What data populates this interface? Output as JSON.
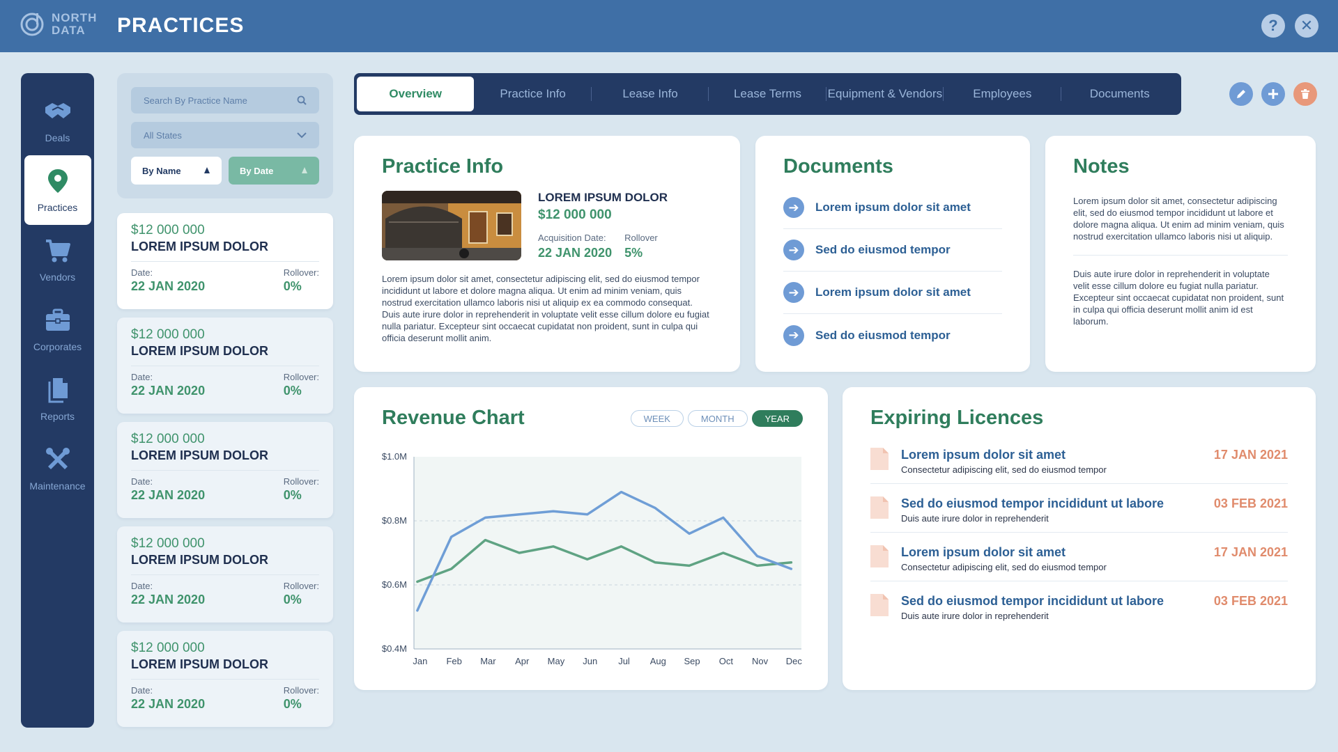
{
  "app": {
    "logo_line1": "NORTH",
    "logo_line2": "DATA",
    "title": "PRACTICES",
    "help_label": "?",
    "close_label": "✕"
  },
  "sidebar": {
    "items": [
      {
        "label": "Deals",
        "icon": "handshake-icon"
      },
      {
        "label": "Practices",
        "icon": "map-pin-icon"
      },
      {
        "label": "Vendors",
        "icon": "cart-icon"
      },
      {
        "label": "Corporates",
        "icon": "briefcase-icon"
      },
      {
        "label": "Reports",
        "icon": "documents-icon"
      },
      {
        "label": "Maintenance",
        "icon": "tools-icon"
      }
    ]
  },
  "filters": {
    "search_placeholder": "Search By Practice Name",
    "states_value": "All States",
    "sort_name": "By Name",
    "sort_date": "By Date"
  },
  "practice_list": [
    {
      "amount": "$12 000 000",
      "name": "LOREM IPSUM DOLOR",
      "date_label": "Date:",
      "date": "22 JAN 2020",
      "rollover_label": "Rollover:",
      "rollover": "0%"
    },
    {
      "amount": "$12 000 000",
      "name": "LOREM IPSUM DOLOR",
      "date_label": "Date:",
      "date": "22 JAN 2020",
      "rollover_label": "Rollover:",
      "rollover": "0%"
    },
    {
      "amount": "$12 000 000",
      "name": "LOREM IPSUM DOLOR",
      "date_label": "Date:",
      "date": "22 JAN 2020",
      "rollover_label": "Rollover:",
      "rollover": "0%"
    },
    {
      "amount": "$12 000 000",
      "name": "LOREM IPSUM DOLOR",
      "date_label": "Date:",
      "date": "22 JAN 2020",
      "rollover_label": "Rollover:",
      "rollover": "0%"
    },
    {
      "amount": "$12 000 000",
      "name": "LOREM IPSUM DOLOR",
      "date_label": "Date:",
      "date": "22 JAN 2020",
      "rollover_label": "Rollover:",
      "rollover": "0%"
    }
  ],
  "tabs": [
    "Overview",
    "Practice Info",
    "Lease Info",
    "Lease Terms",
    "Equipment & Vendors",
    "Employees",
    "Documents"
  ],
  "practice_info": {
    "title": "Practice Info",
    "name": "LOREM IPSUM DOLOR",
    "amount": "$12 000 000",
    "acq_label": "Acquisition Date:",
    "acq_date": "22 JAN 2020",
    "rollover_label": "Rollover",
    "rollover": "5%",
    "description": "Lorem ipsum dolor sit amet, consectetur adipiscing elit, sed do eiusmod tempor incididunt ut labore et dolore magna aliqua. Ut enim ad minim veniam, quis nostrud exercitation ullamco laboris nisi ut aliquip ex ea commodo consequat. Duis aute irure dolor in reprehenderit in voluptate velit esse cillum dolore eu fugiat nulla pariatur. Excepteur sint occaecat cupidatat non proident, sunt in culpa qui officia deserunt mollit anim."
  },
  "documents": {
    "title": "Documents",
    "items": [
      "Lorem ipsum dolor sit amet",
      "Sed do eiusmod tempor",
      "Lorem ipsum dolor sit amet",
      "Sed do eiusmod tempor"
    ]
  },
  "notes": {
    "title": "Notes",
    "p1": "Lorem ipsum dolor sit amet, consectetur adipiscing elit, sed do eiusmod tempor incididunt ut labore et dolore magna aliqua. Ut enim ad minim veniam, quis nostrud exercitation ullamco laboris nisi ut aliquip.",
    "p2": "Duis aute irure dolor in reprehenderit in voluptate velit esse cillum dolore eu fugiat nulla pariatur. Excepteur sint occaecat cupidatat non proident, sunt in culpa qui officia deserunt mollit anim id est laborum."
  },
  "revenue": {
    "title": "Revenue Chart",
    "periods": [
      "WEEK",
      "MONTH",
      "YEAR"
    ],
    "active_period": "YEAR"
  },
  "chart_data": {
    "type": "line",
    "categories": [
      "Jan",
      "Feb",
      "Mar",
      "Apr",
      "May",
      "Jun",
      "Jul",
      "Aug",
      "Sep",
      "Oct",
      "Nov",
      "Dec"
    ],
    "x": [
      0,
      1,
      2,
      3,
      4,
      5,
      6,
      7,
      8,
      9,
      10,
      11
    ],
    "series": [
      {
        "color": "#6f9ed6",
        "values": [
          0.52,
          0.75,
          0.81,
          0.82,
          0.83,
          0.82,
          0.89,
          0.84,
          0.76,
          0.81,
          0.69,
          0.65
        ]
      },
      {
        "color": "#5fa383",
        "values": [
          0.61,
          0.65,
          0.74,
          0.7,
          0.72,
          0.68,
          0.72,
          0.67,
          0.66,
          0.7,
          0.66,
          0.67
        ]
      }
    ],
    "xlim": [
      -0.1,
      11.3
    ],
    "ylim": [
      0.4,
      1.0
    ],
    "yticks": [
      0.4,
      0.6,
      0.8,
      1.0
    ],
    "ytick_labels": [
      "$0.4M",
      "$0.6M",
      "$0.8M",
      "$1.0M"
    ],
    "grid": true
  },
  "licences": {
    "title": "Expiring Licences",
    "items": [
      {
        "title": "Lorem ipsum dolor sit amet",
        "subtitle": "Consectetur adipiscing elit, sed do eiusmod tempor",
        "date": "17 JAN 2021"
      },
      {
        "title": "Sed do eiusmod tempor incididunt ut labore",
        "subtitle": "Duis aute irure dolor in reprehenderit",
        "date": "03 FEB 2021"
      },
      {
        "title": "Lorem ipsum dolor sit amet",
        "subtitle": "Consectetur adipiscing elit, sed do eiusmod tempor",
        "date": "17 JAN 2021"
      },
      {
        "title": "Sed do eiusmod tempor incididunt ut labore",
        "subtitle": "Duis aute irure dolor in reprehenderit",
        "date": "03 FEB 2021"
      }
    ]
  },
  "colors": {
    "topbar": "#3f6fa6",
    "sidebar": "#233a64",
    "accent_green": "#2f7d5c",
    "accent_blue": "#6f9bd5",
    "delete": "#e8987a"
  }
}
